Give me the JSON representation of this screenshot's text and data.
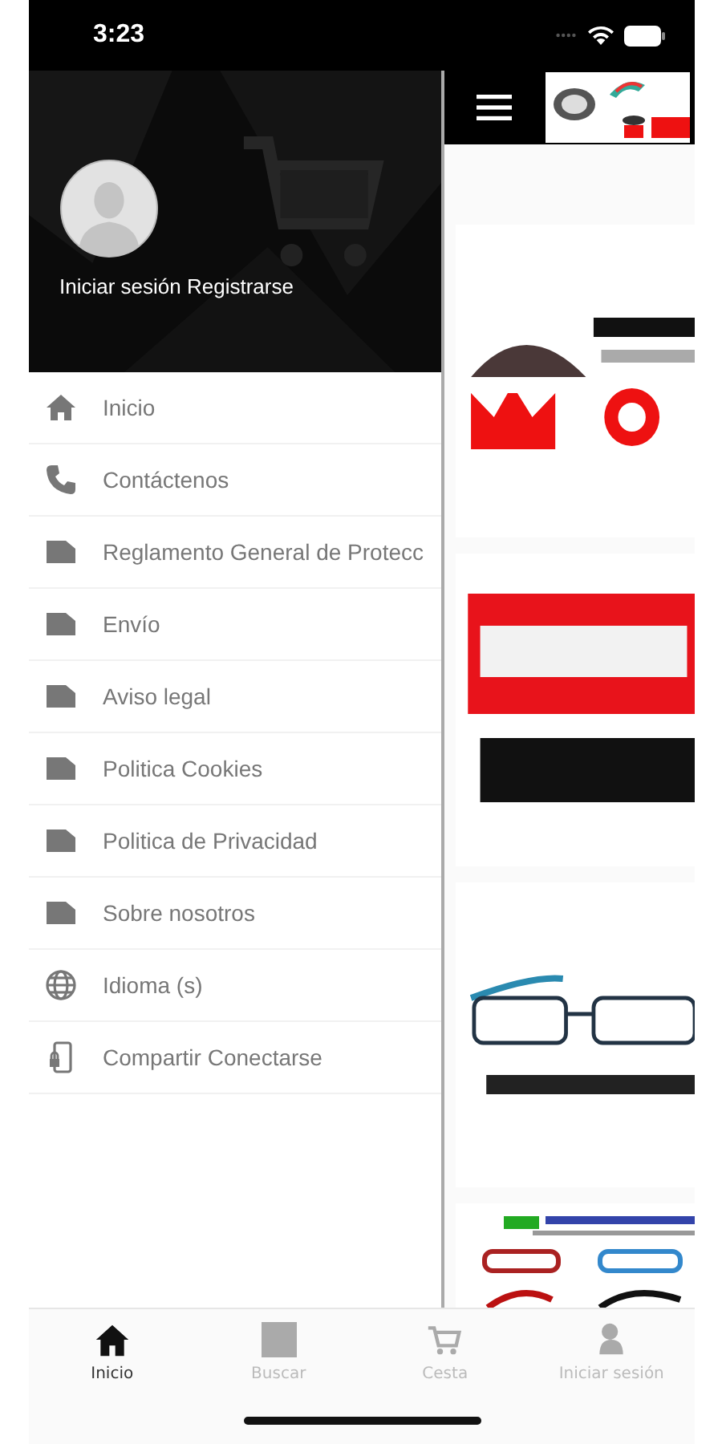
{
  "status_bar": {
    "time": "3:23"
  },
  "drawer": {
    "header": {
      "auth_text": "Iniciar sesión Registrarse"
    },
    "items": [
      {
        "label": "Inicio",
        "kind": "home"
      },
      {
        "label": "Contáctenos",
        "kind": "phone"
      },
      {
        "label": "Reglamento General de Protecc",
        "kind": "page"
      },
      {
        "label": "Envío",
        "kind": "page"
      },
      {
        "label": "Aviso legal",
        "kind": "page"
      },
      {
        "label": "Politica Cookies",
        "kind": "page"
      },
      {
        "label": "Politica de Privacidad",
        "kind": "page"
      },
      {
        "label": "Sobre nosotros",
        "kind": "page"
      },
      {
        "label": "Idioma (s)",
        "kind": "globe"
      },
      {
        "label": "Compartir Conectarse",
        "kind": "share"
      }
    ]
  },
  "tab_bar": [
    {
      "label": "Inicio",
      "kind": "home",
      "selected": true
    },
    {
      "label": "Buscar",
      "kind": "search",
      "selected": false
    },
    {
      "label": "Cesta",
      "kind": "cart",
      "selected": false
    },
    {
      "label": "Iniciar sesión",
      "kind": "user",
      "selected": false
    }
  ]
}
